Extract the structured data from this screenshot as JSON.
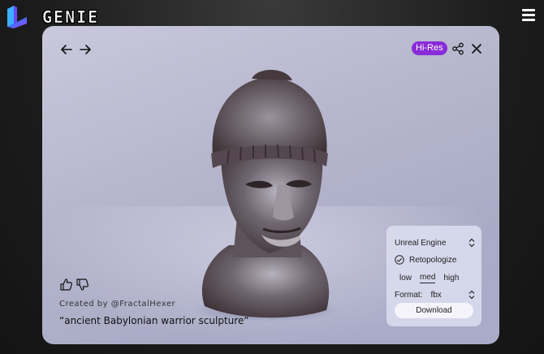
{
  "header": {
    "brand": "GENIE",
    "logo_icon": "genie-logo-icon",
    "menu_icon": "hamburger-menu-icon"
  },
  "viewer": {
    "nav": {
      "back_icon": "arrow-left-icon",
      "forward_icon": "arrow-right-icon"
    },
    "badge": "Hi-Res",
    "share_icon": "share-icon",
    "close_icon": "close-icon",
    "model_subject": "bronze warrior head sculpture",
    "feedback": {
      "like_icon": "thumbs-up-icon",
      "dislike_icon": "thumbs-down-icon"
    },
    "creator": "Created by @FractalHexer",
    "prompt": "“ancient Babylonian warrior sculpture”"
  },
  "export_panel": {
    "engine": "Unreal Engine",
    "retopologize_label": "Retopologize",
    "retopologize_checked": true,
    "density_options": [
      "low",
      "med",
      "high"
    ],
    "density_selected": "med",
    "format_label": "Format:",
    "format_value": "fbx",
    "download_label": "Download"
  },
  "colors": {
    "badge_bg": "#8a2bd8",
    "viewer_bg": "#b6b6cd",
    "page_bg": "#1c1c1c"
  }
}
